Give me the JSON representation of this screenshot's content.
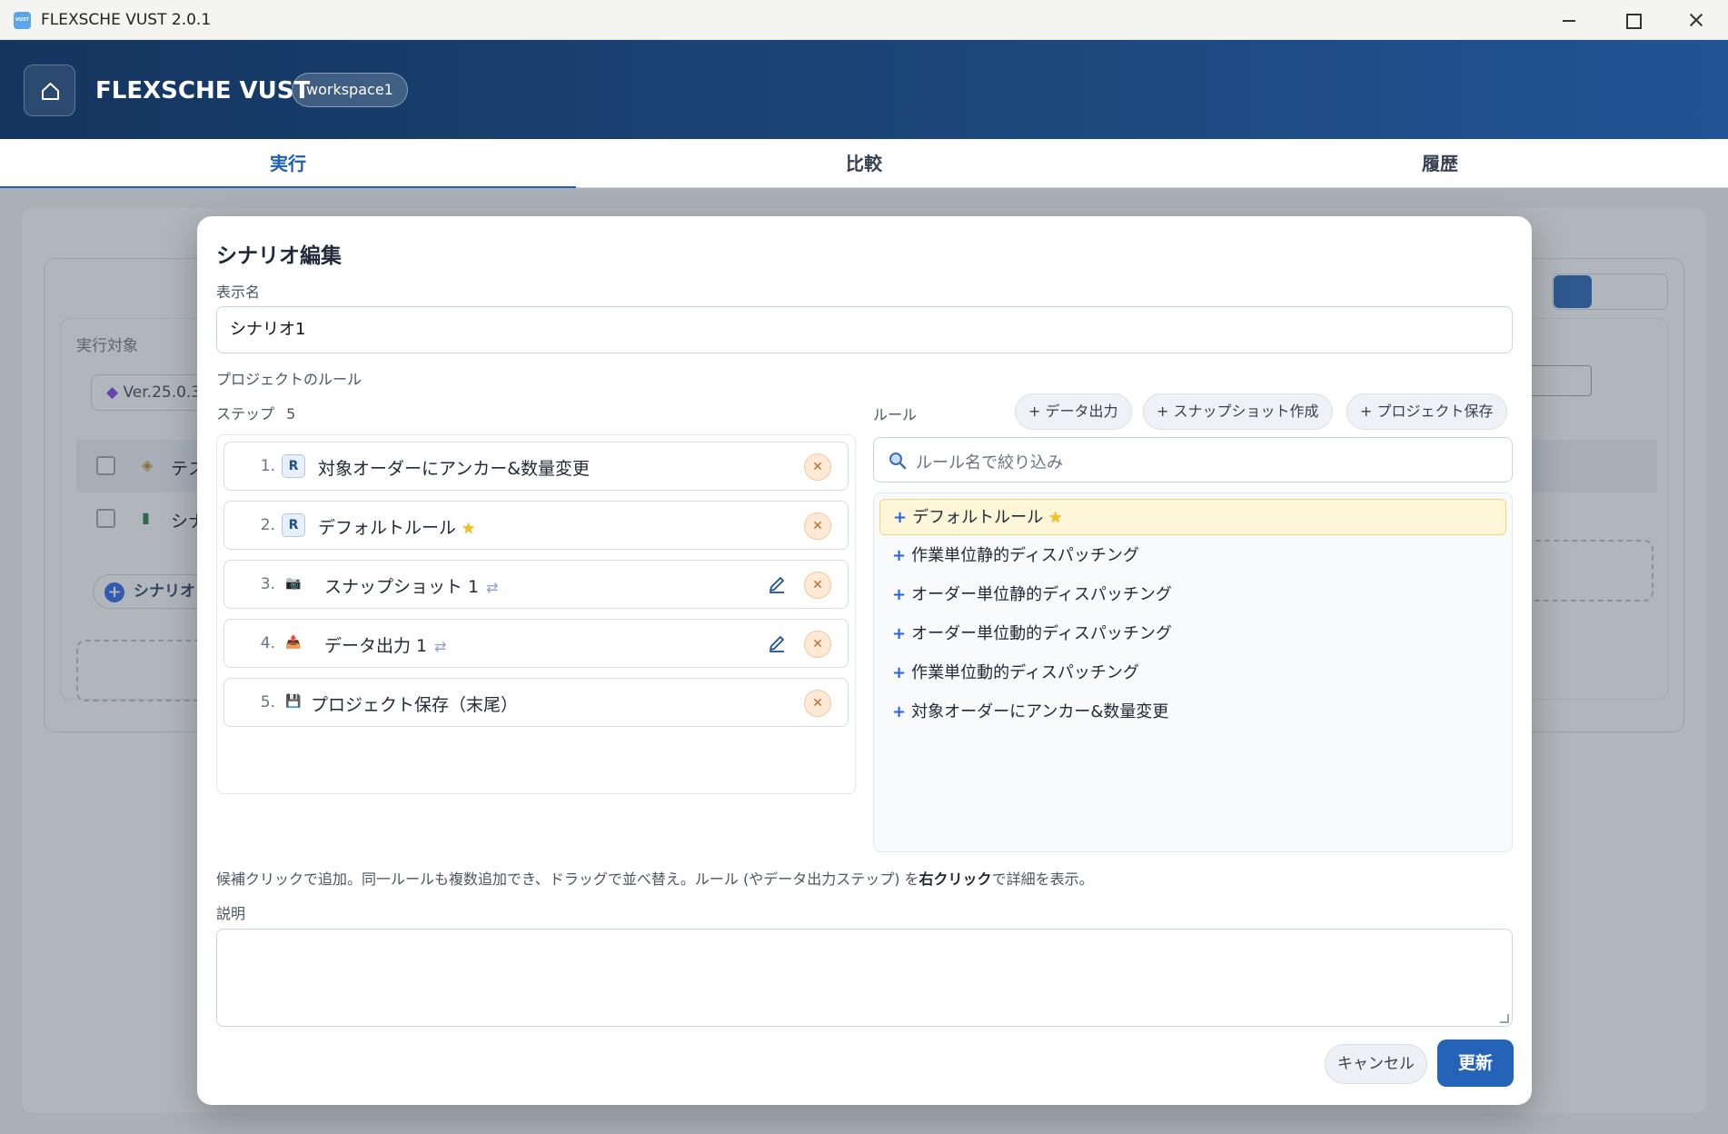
{
  "window": {
    "title": "FLEXSCHE VUST 2.0.1",
    "app_icon_text": "VUST"
  },
  "header": {
    "app_name": "FLEXSCHE VUST",
    "workspace": "workspace1"
  },
  "tabs": [
    {
      "label": "実行"
    },
    {
      "label": "比較"
    },
    {
      "label": "履歴"
    }
  ],
  "background": {
    "target_label": "実行対象",
    "version": "Ver.25.0.3",
    "row1": "テス",
    "row2": "シナ",
    "add_scenario": "シナリオ"
  },
  "modal": {
    "title": "シナリオ編集",
    "display_name_label": "表示名",
    "display_name_value": "シナリオ1",
    "project_rules_label": "プロジェクトのルール",
    "steps_label": "ステップ",
    "steps_count": "5",
    "steps": [
      {
        "num": "1.",
        "label": "対象オーダーにアンカー&数量変更",
        "icon": "R"
      },
      {
        "num": "2.",
        "label": "デフォルトルール",
        "icon": "R"
      },
      {
        "num": "3.",
        "label": "スナップショット 1",
        "icon": "📷"
      },
      {
        "num": "4.",
        "label": "データ出力 1",
        "icon": "📤"
      },
      {
        "num": "5.",
        "label": "プロジェクト保存（末尾）",
        "icon": "💾"
      }
    ],
    "rules_label": "ルール",
    "rule_buttons": [
      "+ データ出力",
      "+ スナップショット作成",
      "+ プロジェクト保存"
    ],
    "search_placeholder": "ルール名で絞り込み",
    "rules": [
      "デフォルトルール",
      "作業単位静的ディスパッチング",
      "オーダー単位静的ディスパッチング",
      "オーダー単位動的ディスパッチング",
      "作業単位動的ディスパッチング",
      "対象オーダーにアンカー&数量変更"
    ],
    "hint_part1": "候補クリックで追加。同一ルールも複数追加でき、ドラッグで並べ替え。ルール (やデータ出力ステップ) を",
    "hint_bold": "右クリック",
    "hint_part2": "で詳細を表示。",
    "description_label": "説明",
    "description_value": "",
    "cancel_label": "キャンセル",
    "update_label": "更新"
  },
  "colors": {
    "accent": "#1d5fb4",
    "header": "#1b4577",
    "star": "#f2c21c",
    "remove": "#fde9d6"
  }
}
